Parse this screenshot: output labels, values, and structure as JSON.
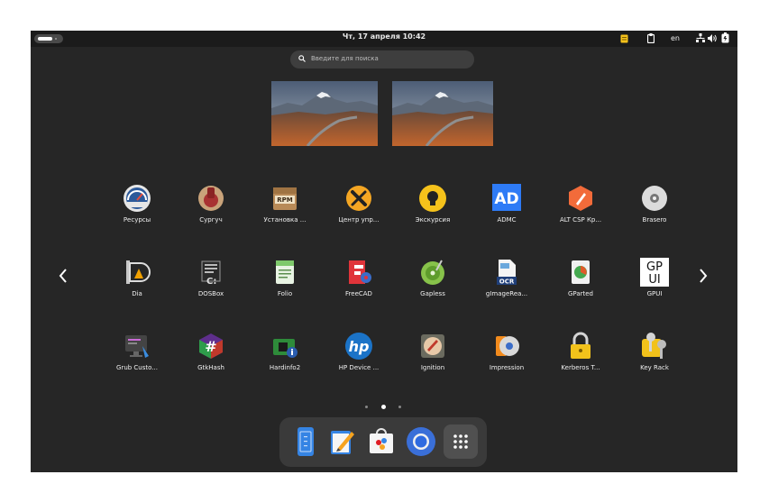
{
  "topbar": {
    "clock": "Чт, 17 апреля  10:42",
    "keyboard_layout": "en",
    "icons": [
      "notes-icon",
      "clipboard-icon",
      "network-icon",
      "volume-icon",
      "battery-icon"
    ]
  },
  "search": {
    "placeholder": "Введите для поиска"
  },
  "workspaces": [
    {
      "name": "workspace-1"
    },
    {
      "name": "workspace-2"
    }
  ],
  "apps": [
    {
      "label": "Ресурсы",
      "icon": "resources-icon"
    },
    {
      "label": "Сургуч",
      "icon": "sealing-wax-icon"
    },
    {
      "label": "Установка ...",
      "icon": "rpm-package-icon"
    },
    {
      "label": "Центр упр...",
      "icon": "control-center-icon"
    },
    {
      "label": "Экскурсия",
      "icon": "lightbulb-icon"
    },
    {
      "label": "ADMC",
      "icon": "admc-icon",
      "icon_text": "AD"
    },
    {
      "label": "ALT CSP Кр...",
      "icon": "alt-csp-icon"
    },
    {
      "label": "Brasero",
      "icon": "disc-icon"
    },
    {
      "label": "Dia",
      "icon": "dia-icon"
    },
    {
      "label": "DOSBox",
      "icon": "dosbox-icon"
    },
    {
      "label": "Folio",
      "icon": "folio-icon"
    },
    {
      "label": "FreeCAD",
      "icon": "freecad-icon"
    },
    {
      "label": "Gapless",
      "icon": "gapless-icon"
    },
    {
      "label": "gImageRea...",
      "icon": "ocr-icon",
      "icon_text": "OCR"
    },
    {
      "label": "GParted",
      "icon": "gparted-icon"
    },
    {
      "label": "GPUI",
      "icon": "gpui-icon",
      "icon_text_1": "GP",
      "icon_text_2": "UI"
    },
    {
      "label": "Grub Custo...",
      "icon": "grub-icon"
    },
    {
      "label": "GtkHash",
      "icon": "hash-icon"
    },
    {
      "label": "Hardinfo2",
      "icon": "hardinfo-icon"
    },
    {
      "label": "HP Device ...",
      "icon": "hp-icon",
      "icon_text": "hp"
    },
    {
      "label": "Ignition",
      "icon": "ignition-icon"
    },
    {
      "label": "Impression",
      "icon": "impression-icon"
    },
    {
      "label": "Kerberos T...",
      "icon": "lock-icon"
    },
    {
      "label": "Key Rack",
      "icon": "keys-icon"
    }
  ],
  "pager": {
    "pages": 3,
    "current": 2
  },
  "dock": [
    {
      "name": "files-icon"
    },
    {
      "name": "text-editor-icon"
    },
    {
      "name": "software-center-icon"
    },
    {
      "name": "chromium-icon"
    },
    {
      "name": "show-apps-icon"
    }
  ],
  "colors": {
    "background": "#262626",
    "topbar": "#1b1b1b",
    "dock": "#3a3a3a"
  }
}
